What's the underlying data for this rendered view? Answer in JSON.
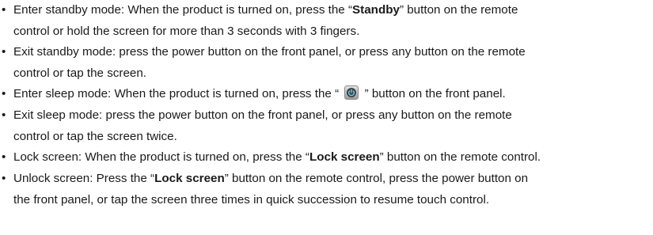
{
  "bullet": "•",
  "items": [
    {
      "l1_pre": "Enter standby mode: When the product is turned on, press the “",
      "l1_bold": "Standby",
      "l1_post": "” button on the remote",
      "l2": "control or hold the screen for more than 3 seconds with 3 fingers."
    },
    {
      "l1": "Exit standby mode: press the power button on the front panel, or press any button on the remote",
      "l2": "control or tap the screen."
    },
    {
      "l1_pre": "Enter sleep mode: When the product is turned on, press the “ ",
      "icon": "power-button-icon",
      "l1_post": " ” button on the front panel."
    },
    {
      "l1": "Exit sleep mode: press the power button on the front panel, or press any button on the remote",
      "l2": "control or tap the screen twice."
    },
    {
      "l1_pre": "Lock screen: When the product is turned on, press the “",
      "l1_bold": "Lock screen",
      "l1_post": "” button on the remote control."
    },
    {
      "l1_pre": "Unlock screen: Press the “",
      "l1_bold": "Lock screen",
      "l1_post": "” button on the remote control, press the power button on",
      "l2": "the front panel, or tap the screen three times in quick succession to resume touch control."
    }
  ]
}
